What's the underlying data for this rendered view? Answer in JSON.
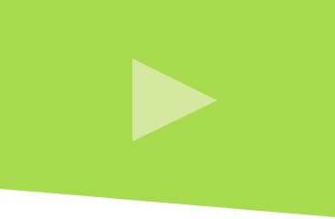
{
  "colors": {
    "background": "#ffffff",
    "panel": "#a8da4e",
    "play_icon": "#d4e99f"
  },
  "icons": {
    "play": "play-icon"
  }
}
